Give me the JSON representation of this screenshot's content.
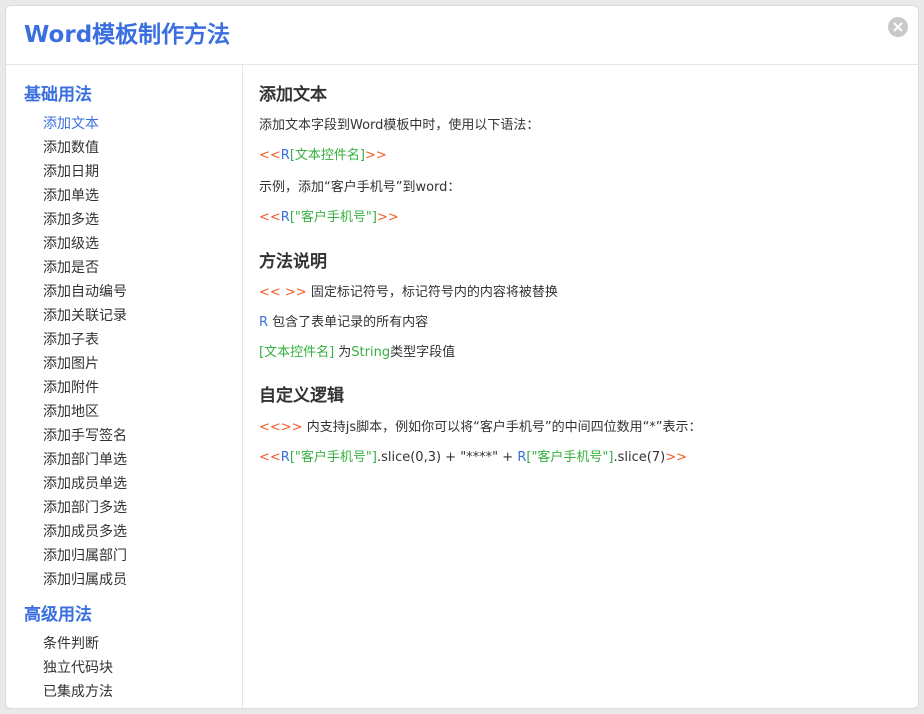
{
  "dialog": {
    "title": "Word模板制作方法"
  },
  "sidebar": {
    "basic_title": "基础用法",
    "basic_items": [
      "添加文本",
      "添加数值",
      "添加日期",
      "添加单选",
      "添加多选",
      "添加级选",
      "添加是否",
      "添加自动编号",
      "添加关联记录",
      "添加子表",
      "添加图片",
      "添加附件",
      "添加地区",
      "添加手写签名",
      "添加部门单选",
      "添加成员单选",
      "添加部门多选",
      "添加成员多选",
      "添加归属部门",
      "添加归属成员"
    ],
    "advanced_title": "高级用法",
    "advanced_items": [
      "条件判断",
      "独立代码块",
      "已集成方法"
    ]
  },
  "content": {
    "s1_title": "添加文本",
    "s1_desc": "添加文本字段到Word模板中时，使用以下语法：",
    "s1_code": {
      "open": "<<",
      "r": "R",
      "field": "[文本控件名]",
      "close": ">>"
    },
    "s1_example_desc": "示例，添加“客户手机号”到word：",
    "s1_example": {
      "open": "<<",
      "r": "R",
      "field": "[\"客户手机号\"]",
      "close": ">>"
    },
    "s2_title": "方法说明",
    "s2_l1": {
      "tag": "<< >>",
      "text": " 固定标记符号，标记符号内的内容将被替换"
    },
    "s2_l2": {
      "tag": "R",
      "text": " 包含了表单记录的所有内容"
    },
    "s2_l3": {
      "tag": "[文本控件名]",
      "mid": " 为",
      "type": "String",
      "text": "类型字段值"
    },
    "s3_title": "自定义逻辑",
    "s3_l1": {
      "tag": "<<>>",
      "text": " 内支持js脚本，例如你可以将“客户手机号”的中间四位数用“*”表示："
    },
    "s3_code": {
      "open": "<<",
      "r1": "R",
      "f1": "[\"客户手机号\"]",
      "m1": ".slice(0,3) + \"****\" + ",
      "r2": "R",
      "f2": "[\"客户手机号\"]",
      "m2": ".slice(7)",
      "close": ">>"
    }
  },
  "colors": {
    "accent": "#3b6fe0",
    "code_orange": "#ef5b25",
    "code_green": "#35b040",
    "text": "#333333"
  },
  "icons": {
    "close": "close-icon"
  }
}
